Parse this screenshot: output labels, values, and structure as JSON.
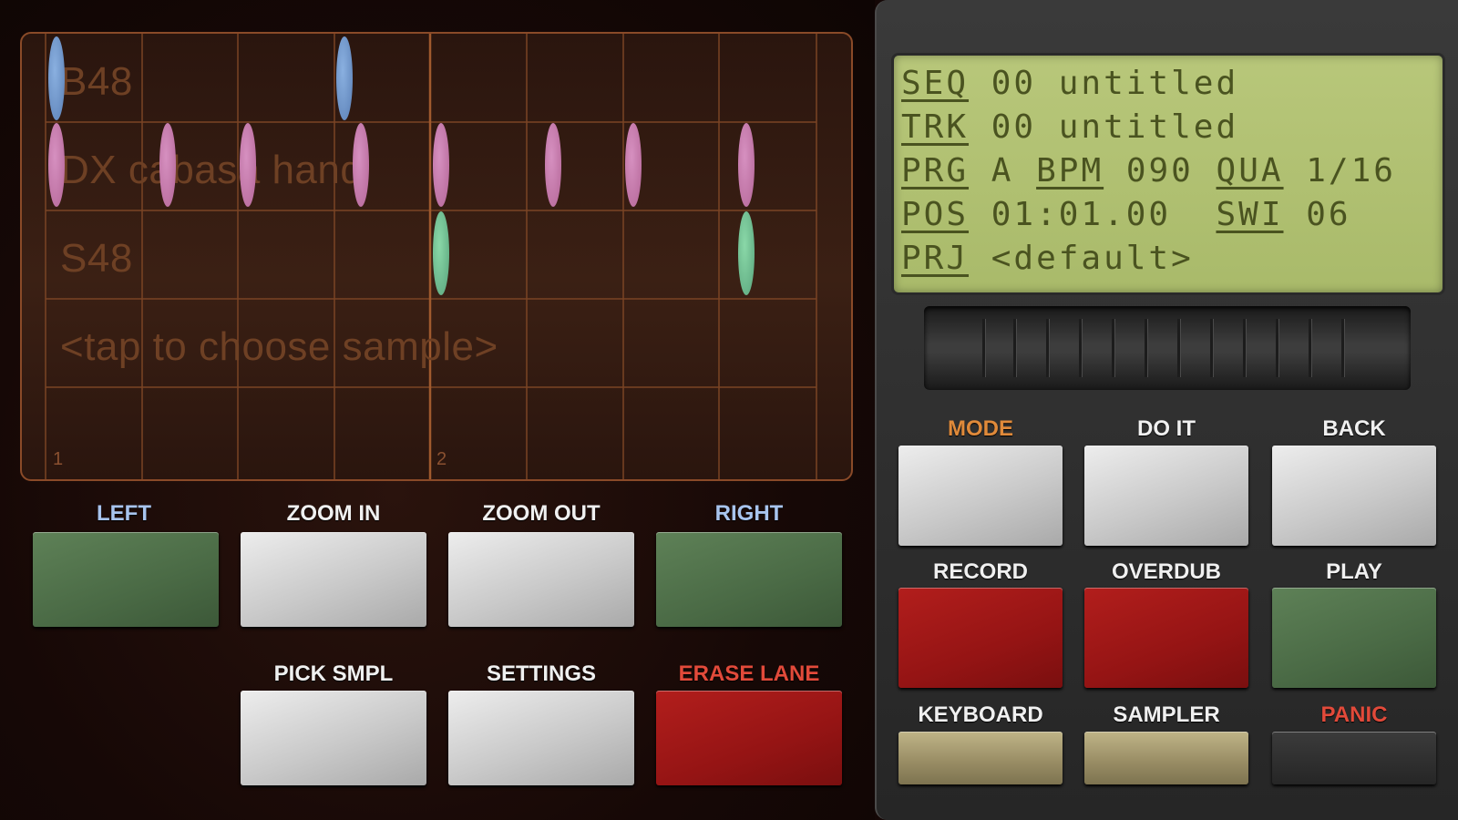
{
  "sequencer": {
    "lanes": [
      {
        "label": "B48"
      },
      {
        "label": "DX cabasa hand"
      },
      {
        "label": "S48"
      },
      {
        "label": "<tap to choose sample>"
      }
    ],
    "bar_numbers": [
      "1",
      "2"
    ]
  },
  "nav_buttons": {
    "left": "LEFT",
    "zoom_in": "ZOOM IN",
    "zoom_out": "ZOOM OUT",
    "right": "RIGHT",
    "pick_smpl": "PICK SMPL",
    "settings": "SETTINGS",
    "erase_lane": "ERASE LANE"
  },
  "lcd": {
    "seq_key": "SEQ",
    "seq_value": "00 untitled",
    "trk_key": "TRK",
    "trk_value": "00 untitled",
    "prg_key": "PRG",
    "prg_value": "A",
    "bpm_key": "BPM",
    "bpm_value": "090",
    "qua_key": "QUA",
    "qua_value": "1/16",
    "pos_key": "POS",
    "pos_value": "01:01.00",
    "swi_key": "SWI",
    "swi_value": "06",
    "prj_key": "PRJ",
    "prj_value": "<default>"
  },
  "transport": {
    "mode": "MODE",
    "do_it": "DO IT",
    "back": "BACK",
    "record": "RECORD",
    "overdub": "OVERDUB",
    "play": "PLAY",
    "keyboard": "KEYBOARD",
    "sampler": "SAMPLER",
    "panic": "PANIC"
  },
  "colors": {
    "label_default": "#f0f0f0",
    "label_blue": "#a8c4ee",
    "label_orange": "#e08a3a",
    "label_red": "#e24a3a",
    "note_blue": "#6f95c9",
    "note_pink": "#c47aa8",
    "note_green": "#6cbd8f",
    "lcd_bg": "#afbf6f"
  },
  "icons": [
    "jog-wheel"
  ]
}
